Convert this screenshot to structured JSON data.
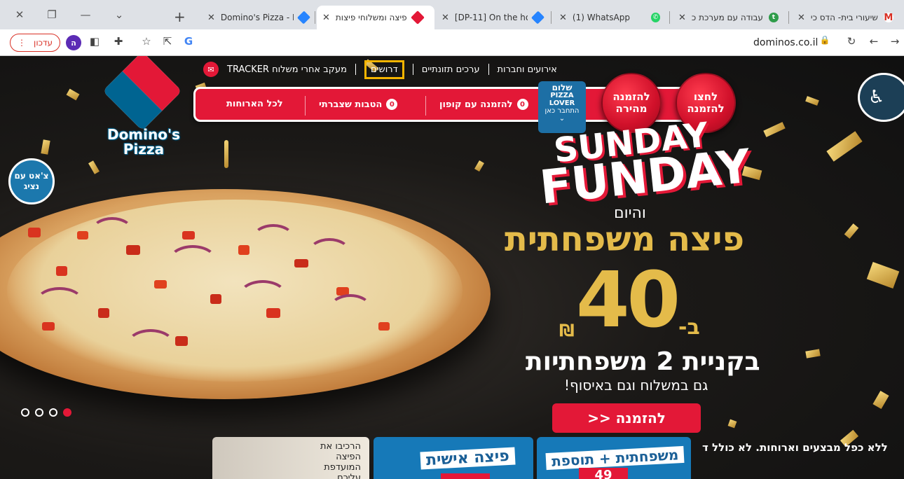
{
  "tabs": [
    {
      "title": "שיעורי בית- הדס כי",
      "favicon": "gmail-icon",
      "color": "#d93025"
    },
    {
      "title": "עבודה עם מערכת כ",
      "favicon": "teams-icon",
      "color": "#2e9c4a"
    },
    {
      "title": "(1) WhatsApp",
      "favicon": "whatsapp-icon",
      "color": "#25d366"
    },
    {
      "title": "[DP-11] On the hor",
      "favicon": "jira-icon",
      "color": "#2684ff"
    },
    {
      "title": "פיצה ומשלוחי פיצות",
      "favicon": "dominos-icon",
      "color": "#e31837"
    },
    {
      "title": "Domino's Pizza - Is",
      "favicon": "jira-icon",
      "color": "#2684ff"
    }
  ],
  "toolbar": {
    "update_label": "עדכון",
    "profile_letter": "ה",
    "url": "dominos.co.il"
  },
  "site": {
    "logo_line1": "Domino's",
    "logo_line2": "Pizza",
    "nav": {
      "events": "אירועים וחברות",
      "nutrition": "ערכים תזונתיים",
      "jobs": "דרושים",
      "tracker": "מעקב אחרי משלוח TRACKER"
    },
    "orderbar": {
      "all_meals": "לכל הארוחות",
      "benefits": "הטבות שצברתי",
      "benefits_count": "0",
      "coupon": "להזמנה עם קופון",
      "coupon_count": "0"
    },
    "lover": {
      "hello": "שלום",
      "brand1": "PIZZA",
      "brand2": "LOVER",
      "join": "התחבר כאן"
    },
    "quick_order": "להזמנה מהירה",
    "click_order": "לחצו להזמנה",
    "chat": "צ'אט עם נציג"
  },
  "promo": {
    "sunday": "SUNDAY",
    "funday": "FUNDAY",
    "today": "והיום",
    "family": "פיצה משפחתית",
    "price": "40",
    "prefix": "ב-",
    "currency": "₪",
    "buy2": "בקניית 2 משפחתיות",
    "also": "גם במשלוח וגם באיסוף!",
    "cta": "להזמנה <<",
    "disclaimer": "ללא כפל מבצעים וארוחות. לא כולל ד"
  },
  "cards": {
    "build": "הרכיבו את הפיצה המועדפת עליכם",
    "personal": "פיצה אישית",
    "family_plus": "משפחתית + תוספת",
    "family_price": "49"
  },
  "slider": {
    "count": 4,
    "active": 4
  }
}
